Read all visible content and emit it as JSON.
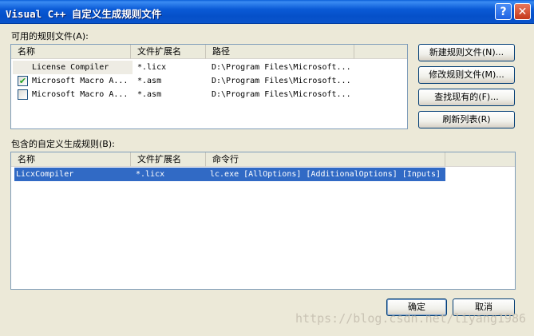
{
  "window": {
    "title": "Visual C++ 自定义生成规则文件",
    "help_glyph": "?",
    "close_glyph": "✕"
  },
  "available": {
    "label": "可用的规则文件(A):",
    "columns": [
      "名称",
      "文件扩展名",
      "路径"
    ],
    "rows": [
      {
        "checked": false,
        "name": "License Compiler",
        "ext": "*.licx",
        "path": "D:\\Program Files\\Microsoft..."
      },
      {
        "checked": true,
        "name": "Microsoft Macro A...",
        "ext": "*.asm",
        "path": "D:\\Program Files\\Microsoft..."
      },
      {
        "checked": false,
        "name": "Microsoft Macro A...",
        "ext": "*.asm",
        "path": "D:\\Program Files\\Microsoft..."
      }
    ]
  },
  "buttons": {
    "new_rule": "新建规则文件(N)...",
    "modify_rule": "修改规则文件(M)...",
    "find_existing": "查找现有的(F)...",
    "refresh": "刷新列表(R)",
    "ok": "确定",
    "cancel": "取消"
  },
  "included": {
    "label": "包含的自定义生成规则(B):",
    "columns": [
      "名称",
      "文件扩展名",
      "命令行"
    ],
    "rows": [
      {
        "name": "LicxCompiler",
        "ext": "*.licx",
        "command": "lc.exe [AllOptions] [AdditionalOptions] [Inputs]"
      }
    ]
  },
  "watermark": "https://blog.csdn.net/liyang1986"
}
